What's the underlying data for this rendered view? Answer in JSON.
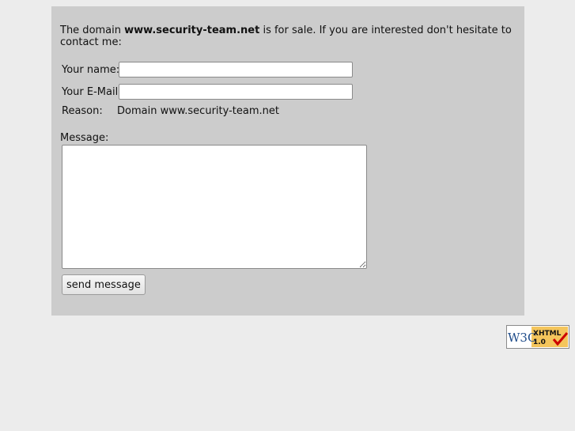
{
  "intro": {
    "prefix": "The domain ",
    "domain": "www.security-team.net",
    "suffix": " is for sale. If you are interested don't hesitate to contact me:"
  },
  "form": {
    "name_label": "Your name:",
    "name_value": "",
    "email_label": "Your E-Mail:",
    "email_value": "",
    "reason_label": "Reason:",
    "reason_value": "Domain www.security-team.net",
    "message_label": "Message:",
    "message_value": "",
    "send_label": "send message"
  },
  "badge": {
    "w3c_text": "W3C",
    "xhtml_text": "XHTML",
    "version_text": "1.0",
    "accent_color": "#f4c55c",
    "check_color": "#cc0000"
  }
}
